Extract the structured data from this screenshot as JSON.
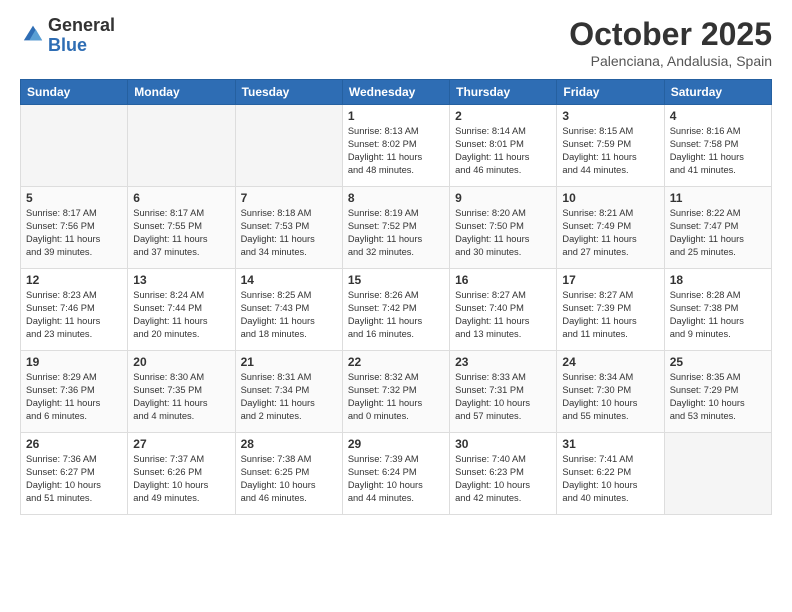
{
  "logo": {
    "line1": "General",
    "line2": "Blue"
  },
  "title": "October 2025",
  "subtitle": "Palenciana, Andalusia, Spain",
  "weekdays": [
    "Sunday",
    "Monday",
    "Tuesday",
    "Wednesday",
    "Thursday",
    "Friday",
    "Saturday"
  ],
  "weeks": [
    [
      {
        "day": null,
        "info": null
      },
      {
        "day": null,
        "info": null
      },
      {
        "day": null,
        "info": null
      },
      {
        "day": "1",
        "info": "Sunrise: 8:13 AM\nSunset: 8:02 PM\nDaylight: 11 hours\nand 48 minutes."
      },
      {
        "day": "2",
        "info": "Sunrise: 8:14 AM\nSunset: 8:01 PM\nDaylight: 11 hours\nand 46 minutes."
      },
      {
        "day": "3",
        "info": "Sunrise: 8:15 AM\nSunset: 7:59 PM\nDaylight: 11 hours\nand 44 minutes."
      },
      {
        "day": "4",
        "info": "Sunrise: 8:16 AM\nSunset: 7:58 PM\nDaylight: 11 hours\nand 41 minutes."
      }
    ],
    [
      {
        "day": "5",
        "info": "Sunrise: 8:17 AM\nSunset: 7:56 PM\nDaylight: 11 hours\nand 39 minutes."
      },
      {
        "day": "6",
        "info": "Sunrise: 8:17 AM\nSunset: 7:55 PM\nDaylight: 11 hours\nand 37 minutes."
      },
      {
        "day": "7",
        "info": "Sunrise: 8:18 AM\nSunset: 7:53 PM\nDaylight: 11 hours\nand 34 minutes."
      },
      {
        "day": "8",
        "info": "Sunrise: 8:19 AM\nSunset: 7:52 PM\nDaylight: 11 hours\nand 32 minutes."
      },
      {
        "day": "9",
        "info": "Sunrise: 8:20 AM\nSunset: 7:50 PM\nDaylight: 11 hours\nand 30 minutes."
      },
      {
        "day": "10",
        "info": "Sunrise: 8:21 AM\nSunset: 7:49 PM\nDaylight: 11 hours\nand 27 minutes."
      },
      {
        "day": "11",
        "info": "Sunrise: 8:22 AM\nSunset: 7:47 PM\nDaylight: 11 hours\nand 25 minutes."
      }
    ],
    [
      {
        "day": "12",
        "info": "Sunrise: 8:23 AM\nSunset: 7:46 PM\nDaylight: 11 hours\nand 23 minutes."
      },
      {
        "day": "13",
        "info": "Sunrise: 8:24 AM\nSunset: 7:44 PM\nDaylight: 11 hours\nand 20 minutes."
      },
      {
        "day": "14",
        "info": "Sunrise: 8:25 AM\nSunset: 7:43 PM\nDaylight: 11 hours\nand 18 minutes."
      },
      {
        "day": "15",
        "info": "Sunrise: 8:26 AM\nSunset: 7:42 PM\nDaylight: 11 hours\nand 16 minutes."
      },
      {
        "day": "16",
        "info": "Sunrise: 8:27 AM\nSunset: 7:40 PM\nDaylight: 11 hours\nand 13 minutes."
      },
      {
        "day": "17",
        "info": "Sunrise: 8:27 AM\nSunset: 7:39 PM\nDaylight: 11 hours\nand 11 minutes."
      },
      {
        "day": "18",
        "info": "Sunrise: 8:28 AM\nSunset: 7:38 PM\nDaylight: 11 hours\nand 9 minutes."
      }
    ],
    [
      {
        "day": "19",
        "info": "Sunrise: 8:29 AM\nSunset: 7:36 PM\nDaylight: 11 hours\nand 6 minutes."
      },
      {
        "day": "20",
        "info": "Sunrise: 8:30 AM\nSunset: 7:35 PM\nDaylight: 11 hours\nand 4 minutes."
      },
      {
        "day": "21",
        "info": "Sunrise: 8:31 AM\nSunset: 7:34 PM\nDaylight: 11 hours\nand 2 minutes."
      },
      {
        "day": "22",
        "info": "Sunrise: 8:32 AM\nSunset: 7:32 PM\nDaylight: 11 hours\nand 0 minutes."
      },
      {
        "day": "23",
        "info": "Sunrise: 8:33 AM\nSunset: 7:31 PM\nDaylight: 10 hours\nand 57 minutes."
      },
      {
        "day": "24",
        "info": "Sunrise: 8:34 AM\nSunset: 7:30 PM\nDaylight: 10 hours\nand 55 minutes."
      },
      {
        "day": "25",
        "info": "Sunrise: 8:35 AM\nSunset: 7:29 PM\nDaylight: 10 hours\nand 53 minutes."
      }
    ],
    [
      {
        "day": "26",
        "info": "Sunrise: 7:36 AM\nSunset: 6:27 PM\nDaylight: 10 hours\nand 51 minutes."
      },
      {
        "day": "27",
        "info": "Sunrise: 7:37 AM\nSunset: 6:26 PM\nDaylight: 10 hours\nand 49 minutes."
      },
      {
        "day": "28",
        "info": "Sunrise: 7:38 AM\nSunset: 6:25 PM\nDaylight: 10 hours\nand 46 minutes."
      },
      {
        "day": "29",
        "info": "Sunrise: 7:39 AM\nSunset: 6:24 PM\nDaylight: 10 hours\nand 44 minutes."
      },
      {
        "day": "30",
        "info": "Sunrise: 7:40 AM\nSunset: 6:23 PM\nDaylight: 10 hours\nand 42 minutes."
      },
      {
        "day": "31",
        "info": "Sunrise: 7:41 AM\nSunset: 6:22 PM\nDaylight: 10 hours\nand 40 minutes."
      },
      {
        "day": null,
        "info": null
      }
    ]
  ]
}
